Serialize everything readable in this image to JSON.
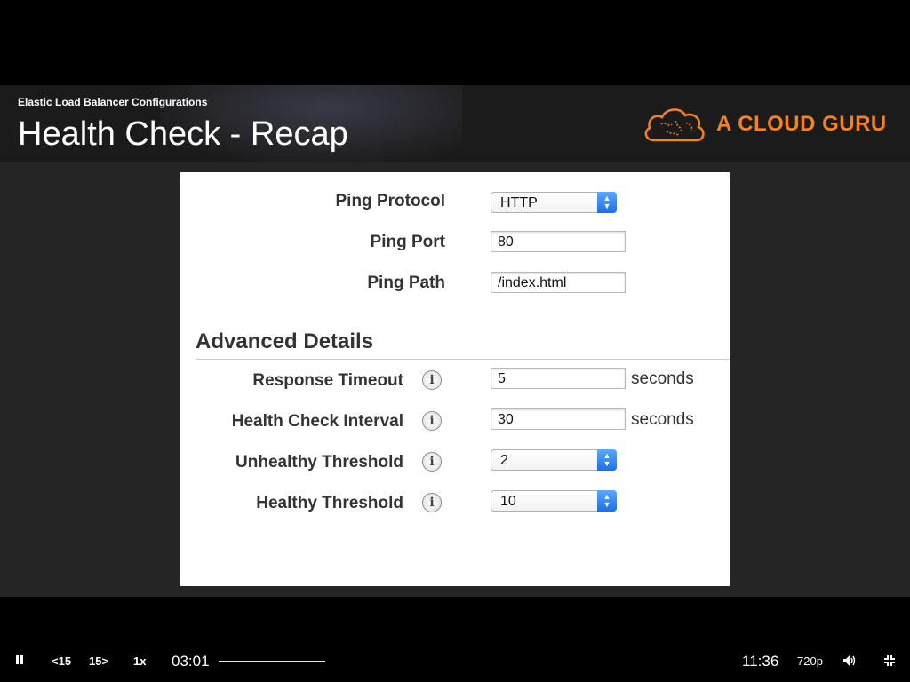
{
  "video": {
    "subtitle": "Elastic Load Balancer Configurations",
    "title": "Health Check - Recap",
    "logo_text": "A CLOUD GURU",
    "logo_icon": "cloud-brain-icon",
    "accent_color": "#f58220"
  },
  "health_check": {
    "ping_protocol": {
      "label": "Ping Protocol",
      "value": "HTTP"
    },
    "ping_port": {
      "label": "Ping Port",
      "value": "80"
    },
    "ping_path": {
      "label": "Ping Path",
      "value": "/index.html"
    }
  },
  "advanced": {
    "heading": "Advanced Details",
    "response_timeout": {
      "label": "Response Timeout",
      "value": "5",
      "unit": "seconds"
    },
    "health_check_interval": {
      "label": "Health Check Interval",
      "value": "30",
      "unit": "seconds"
    },
    "unhealthy_threshold": {
      "label": "Unhealthy Threshold",
      "value": "2"
    },
    "healthy_threshold": {
      "label": "Healthy Threshold",
      "value": "10"
    },
    "info_glyph": "i"
  },
  "player": {
    "back_label": "15",
    "forward_label": "15",
    "speed": "1x",
    "current_time": "03:01",
    "duration": "11:36",
    "quality": "720p"
  }
}
